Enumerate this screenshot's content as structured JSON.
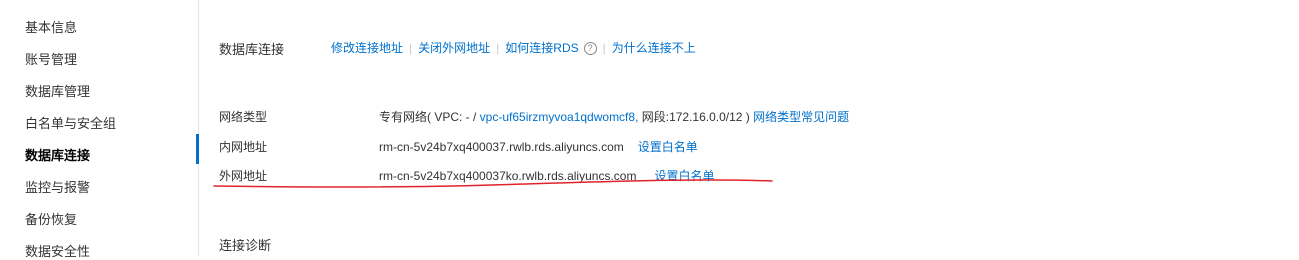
{
  "sidebar": {
    "items": [
      {
        "label": "基本信息"
      },
      {
        "label": "账号管理"
      },
      {
        "label": "数据库管理"
      },
      {
        "label": "白名单与安全组"
      },
      {
        "label": "数据库连接"
      },
      {
        "label": "监控与报警"
      },
      {
        "label": "备份恢复"
      },
      {
        "label": "数据安全性"
      }
    ],
    "active_index": 4
  },
  "connection": {
    "title": "数据库连接",
    "actions": {
      "modify_address": "修改连接地址",
      "close_public": "关闭外网地址",
      "how_to_connect": "如何连接RDS",
      "why_cannot_connect": "为什么连接不上"
    }
  },
  "network_type": {
    "label": "网络类型",
    "prefix": "专有网络( VPC: - / ",
    "vpc_id": "vpc-uf65irzmyvoa1qdwomcf8,",
    "segment": " 网段:172.16.0.0/12 ) ",
    "faq_link": "网络类型常见问题"
  },
  "internal": {
    "label": "内网地址",
    "address": "rm-cn-5v24b7xq400037.rwlb.rds.aliyuncs.com",
    "whitelist_link": "设置白名单"
  },
  "external": {
    "label": "外网地址",
    "address": "rm-cn-5v24b7xq400037ko.rwlb.rds.aliyuncs.com",
    "whitelist_link": "设置白名单"
  },
  "diagnosis": {
    "title": "连接诊断"
  },
  "annotation": {
    "color": "#e0242a"
  }
}
